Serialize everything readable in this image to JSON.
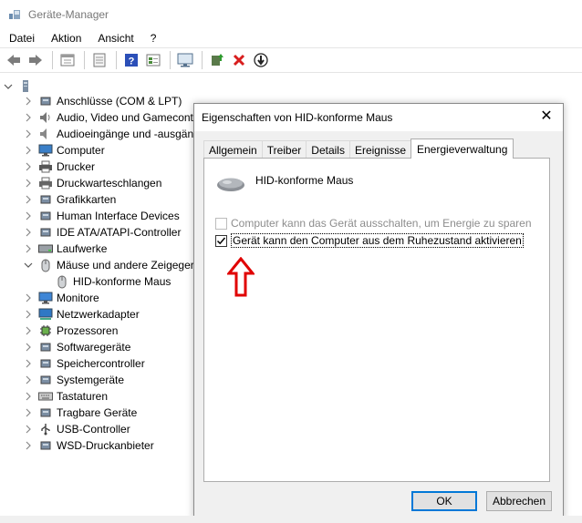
{
  "window": {
    "title": "Geräte-Manager"
  },
  "menu": [
    "Datei",
    "Aktion",
    "Ansicht",
    "?"
  ],
  "toolbar": {
    "buttons": [
      "back-icon",
      "forward-icon",
      "properties-view-icon",
      "driver-icon",
      "help-icon",
      "device-view-icon",
      "monitor-scan-icon",
      "update-driver-icon",
      "uninstall-icon",
      "disable-device-icon"
    ]
  },
  "tree": {
    "items": [
      {
        "label": "Anschlüsse (COM & LPT)",
        "icon": "port-icon"
      },
      {
        "label": "Audio, Video und Gamecont",
        "icon": "audio-icon"
      },
      {
        "label": "Audioeingänge und -ausgän",
        "icon": "audio-io-icon"
      },
      {
        "label": "Computer",
        "icon": "computer-icon"
      },
      {
        "label": "Drucker",
        "icon": "printer-icon"
      },
      {
        "label": "Druckwarteschlangen",
        "icon": "print-queue-icon"
      },
      {
        "label": "Grafikkarten",
        "icon": "graphics-card-icon"
      },
      {
        "label": "Human Interface Devices",
        "icon": "hid-icon"
      },
      {
        "label": "IDE ATA/ATAPI-Controller",
        "icon": "ide-icon"
      },
      {
        "label": "Laufwerke",
        "icon": "drive-icon"
      },
      {
        "label": "Mäuse und andere Zeigeger",
        "icon": "mouse-icon",
        "expanded": true
      },
      {
        "label": "HID-konforme Maus",
        "icon": "mouse-icon",
        "child": true
      },
      {
        "label": "Monitore",
        "icon": "monitor-icon"
      },
      {
        "label": "Netzwerkadapter",
        "icon": "network-icon"
      },
      {
        "label": "Prozessoren",
        "icon": "cpu-icon"
      },
      {
        "label": "Softwaregeräte",
        "icon": "software-device-icon"
      },
      {
        "label": "Speichercontroller",
        "icon": "storage-icon"
      },
      {
        "label": "Systemgeräte",
        "icon": "system-device-icon"
      },
      {
        "label": "Tastaturen",
        "icon": "keyboard-icon"
      },
      {
        "label": "Tragbare Geräte",
        "icon": "portable-device-icon"
      },
      {
        "label": "USB-Controller",
        "icon": "usb-icon"
      },
      {
        "label": "WSD-Druckanbieter",
        "icon": "wsd-icon"
      }
    ]
  },
  "dialog": {
    "title": "Eigenschaften von HID-konforme Maus",
    "tabs": [
      "Allgemein",
      "Treiber",
      "Details",
      "Ereignisse",
      "Energieverwaltung"
    ],
    "active_tab": "Energieverwaltung",
    "device_name": "HID-konforme Maus",
    "options": [
      {
        "label": "Computer kann das Gerät ausschalten, um Energie zu sparen",
        "checked": false,
        "enabled": false
      },
      {
        "label": "Gerät kann den Computer aus dem Ruhezustand aktivieren",
        "checked": true,
        "enabled": true
      }
    ],
    "ok_label": "OK",
    "cancel_label": "Abbrechen",
    "annotation_color": "#e00000"
  }
}
